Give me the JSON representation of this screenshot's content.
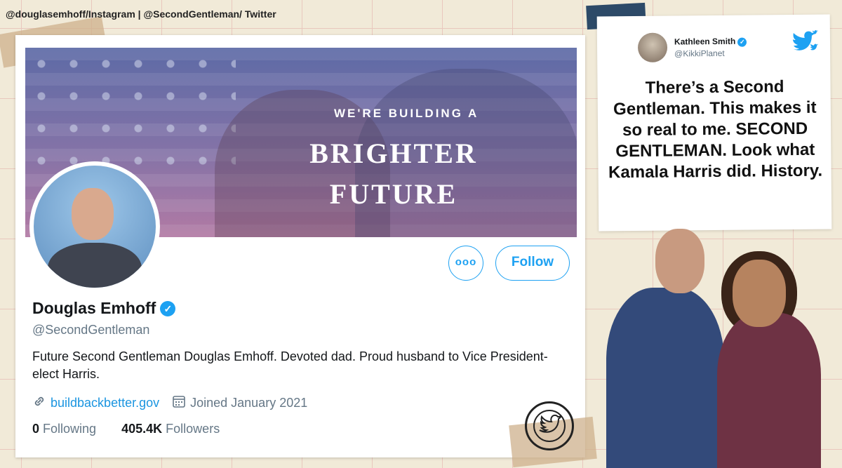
{
  "credit": "@douglasemhoff/Instagram | @SecondGentleman/ Twitter",
  "profile": {
    "banner_small": "WE'RE BUILDING A",
    "banner_line1": "BRIGHTER",
    "banner_line2": "FUTURE",
    "more_label": "ooo",
    "follow_label": "Follow",
    "name": "Douglas Emhoff",
    "handle": "@SecondGentleman",
    "bio": "Future Second Gentleman Douglas Emhoff. Devoted dad. Proud husband to Vice President-elect Harris.",
    "website": "buildbackbetter.gov",
    "joined": "Joined January 2021",
    "following_count": "0",
    "following_label": "Following",
    "followers_count": "405.4K",
    "followers_label": "Followers"
  },
  "tweet": {
    "author_name": "Kathleen Smith",
    "author_handle": "@KikkiPlanet",
    "text": "There’s a Second Gentleman. This makes it so real to me. SECOND GENTLEMAN. Look what Kamala Harris did. History."
  },
  "colors": {
    "twitter_blue": "#1da1f2",
    "background": "#f1ead8"
  },
  "icons": [
    "link-icon",
    "calendar-icon",
    "verified-icon",
    "twitter-bird-icon",
    "more-icon"
  ]
}
